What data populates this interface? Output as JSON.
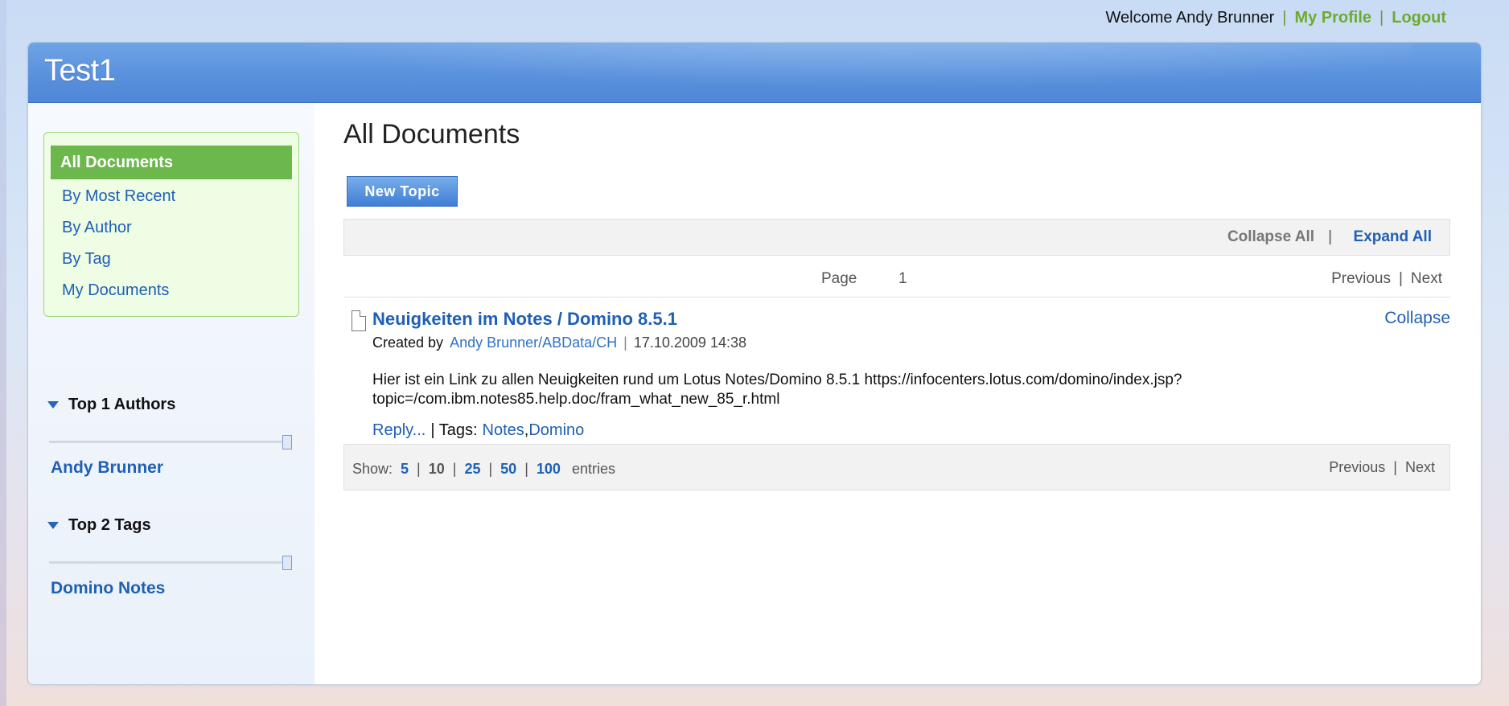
{
  "header": {
    "welcome": "Welcome Andy Brunner",
    "separator": "|",
    "my_profile": "My Profile",
    "logout": "Logout"
  },
  "app": {
    "title": "Test1"
  },
  "sidebar": {
    "nav": {
      "active": "All Documents",
      "items": [
        "By Most Recent",
        "By Author",
        "By Tag",
        "My Documents"
      ]
    },
    "authors": {
      "title": "Top 1 Authors",
      "slider_value": 1,
      "items": [
        "Andy Brunner"
      ]
    },
    "tags": {
      "title": "Top 2 Tags",
      "slider_value": 2,
      "items": [
        "Domino Notes"
      ]
    }
  },
  "main": {
    "title": "All Documents",
    "new_topic_label": "New Topic",
    "toolbar": {
      "collapse_all": "Collapse All",
      "separator": "|",
      "expand_all": "Expand All"
    },
    "pager": {
      "page_label": "Page",
      "page_number": "1",
      "previous": "Previous",
      "separator": "|",
      "next": "Next"
    },
    "document": {
      "title": "Neuigkeiten im Notes / Domino 8.5.1",
      "collapse": "Collapse",
      "created_by_label": "Created by",
      "author": "Andy Brunner/ABData/CH",
      "separator": "|",
      "date": "17.10.2009 14:38",
      "body": "Hier ist ein Link zu allen Neuigkeiten rund um Lotus Notes/Domino 8.5.1 https://infocenters.lotus.com/domino/index.jsp?topic=/com.ibm.notes85.help.doc/fram_what_new_85_r.html",
      "reply": "Reply...",
      "tags_label": "| Tags:",
      "tags": [
        "Notes",
        "Domino"
      ],
      "tag_separator": ","
    },
    "footer": {
      "show_label": "Show:",
      "sizes": [
        "5",
        "10",
        "25",
        "50",
        "100"
      ],
      "separator": "|",
      "entries_label": "entries",
      "previous": "Previous",
      "next": "Next"
    }
  },
  "colors": {
    "accent_blue": "#1f5fb5",
    "banner_blue": "#5a91dd",
    "active_green": "#6cb84c",
    "header_link_green": "#6cab2f"
  }
}
